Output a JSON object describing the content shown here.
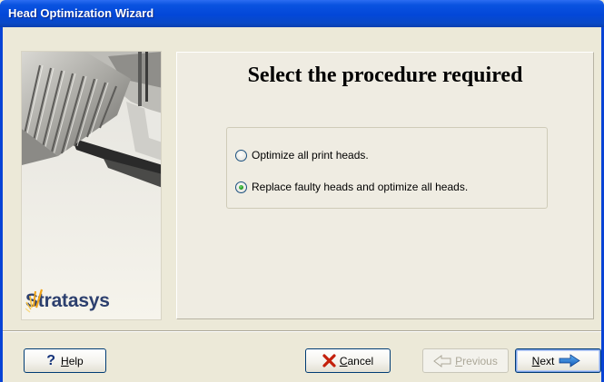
{
  "window": {
    "title": "Head Optimization Wizard"
  },
  "branding": {
    "logo_text": "Stratasys"
  },
  "page": {
    "heading": "Select the procedure required",
    "options": [
      {
        "label": "Optimize all print heads.",
        "selected": false
      },
      {
        "label": "Replace faulty heads and optimize all heads.",
        "selected": true
      }
    ]
  },
  "buttons": {
    "help": "Help",
    "cancel": "Cancel",
    "previous": "Previous",
    "next": "Next"
  },
  "colors": {
    "titlebar": "#0a53e0",
    "background": "#ece9d8",
    "radio_selected": "#21a121",
    "next_arrow": "#1f7fd6",
    "cancel_x": "#c4200c"
  }
}
